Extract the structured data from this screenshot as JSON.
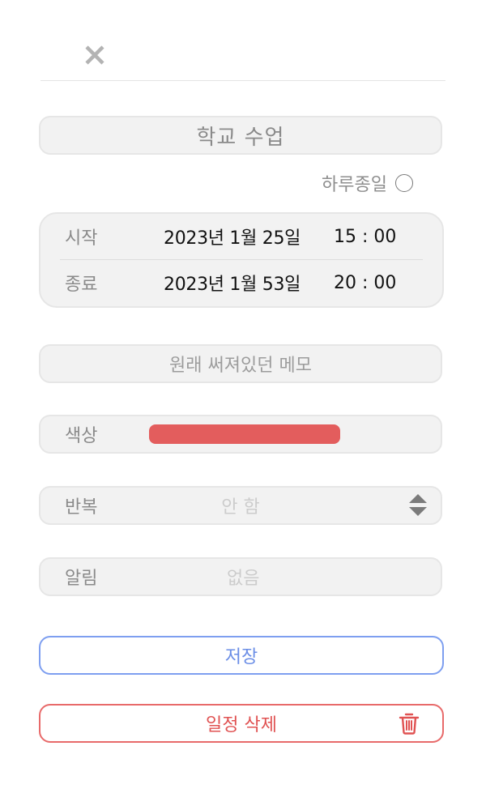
{
  "header": {
    "close_icon": "close-icon"
  },
  "title": {
    "value": "학교 수업"
  },
  "all_day": {
    "label": "하루종일",
    "checked": false
  },
  "schedule": {
    "start": {
      "label": "시작",
      "date": "2023년 1월 25일",
      "time": "15 : 00"
    },
    "end": {
      "label": "종료",
      "date": "2023년 1월 53일",
      "time": "20 : 00"
    }
  },
  "memo": {
    "value": "원래 써져있던 메모"
  },
  "color": {
    "label": "색상",
    "value": "#e35d5d"
  },
  "repeat": {
    "label": "반복",
    "value": "안 함",
    "icon": "updown-icon"
  },
  "alarm": {
    "label": "알림",
    "value": "없음"
  },
  "actions": {
    "save_label": "저장",
    "delete_label": "일정 삭제",
    "delete_icon": "trash-icon",
    "save_color": "#6a8de6",
    "delete_color": "#e05252"
  }
}
